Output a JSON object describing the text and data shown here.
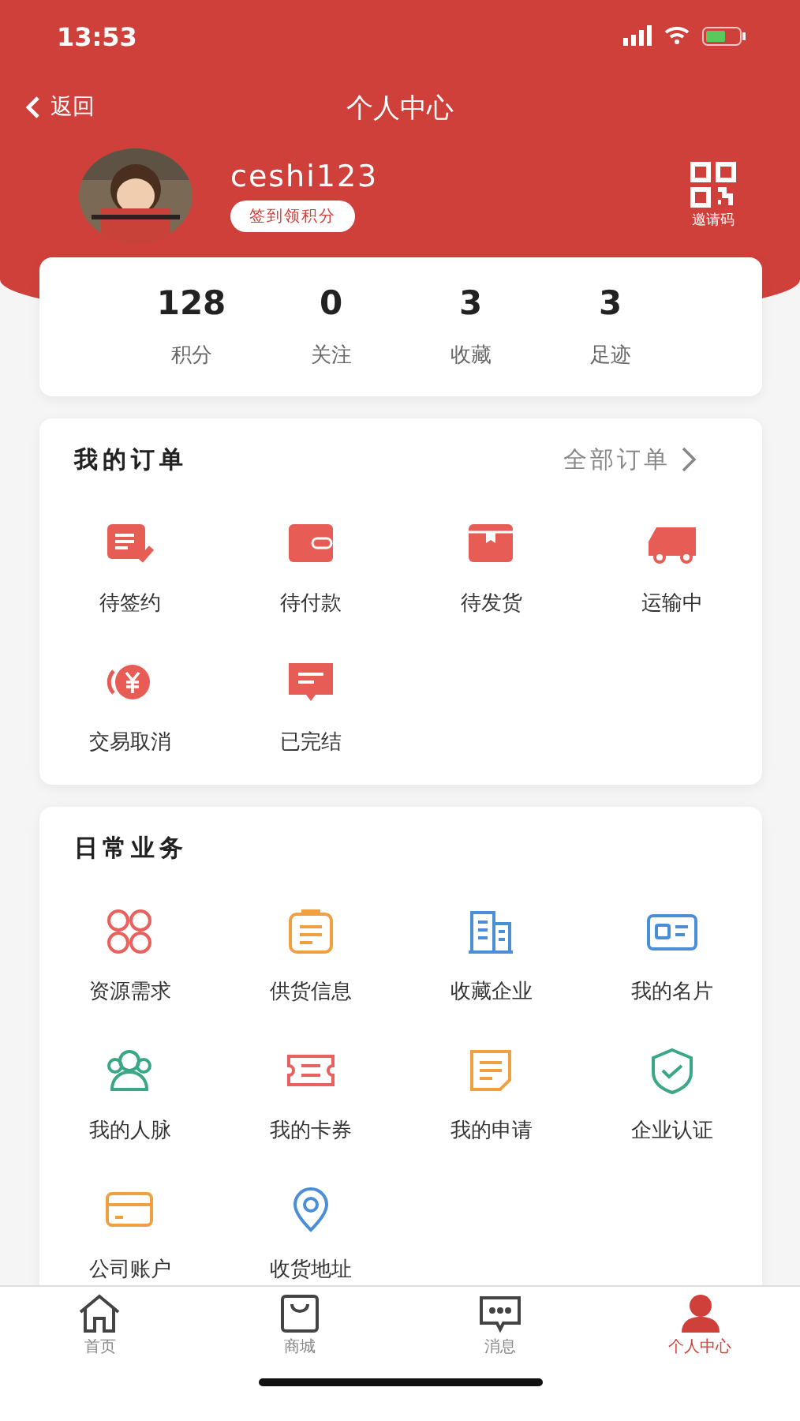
{
  "status_bar": {
    "time": "13:53"
  },
  "nav": {
    "back": "返回",
    "title": "个人中心"
  },
  "profile": {
    "username": "ceshi123",
    "checkin_button": "签到领积分",
    "invite_label": "邀请码"
  },
  "stats": [
    {
      "value": "128",
      "label": "积分"
    },
    {
      "value": "0",
      "label": "关注"
    },
    {
      "value": "3",
      "label": "收藏"
    },
    {
      "value": "3",
      "label": "足迹"
    }
  ],
  "orders": {
    "title": "我的订单",
    "all_link": "全部订单",
    "items": [
      "待签约",
      "待付款",
      "待发货",
      "运输中",
      "交易取消",
      "已完结"
    ]
  },
  "daily": {
    "title": "日常业务",
    "items": [
      "资源需求",
      "供货信息",
      "收藏企业",
      "我的名片",
      "我的人脉",
      "我的卡券",
      "我的申请",
      "企业认证",
      "公司账户",
      "收货地址"
    ]
  },
  "tab_bar": [
    {
      "label": "首页",
      "selected": false
    },
    {
      "label": "商城",
      "selected": false
    },
    {
      "label": "消息",
      "selected": false
    },
    {
      "label": "个人中心",
      "selected": true
    }
  ]
}
